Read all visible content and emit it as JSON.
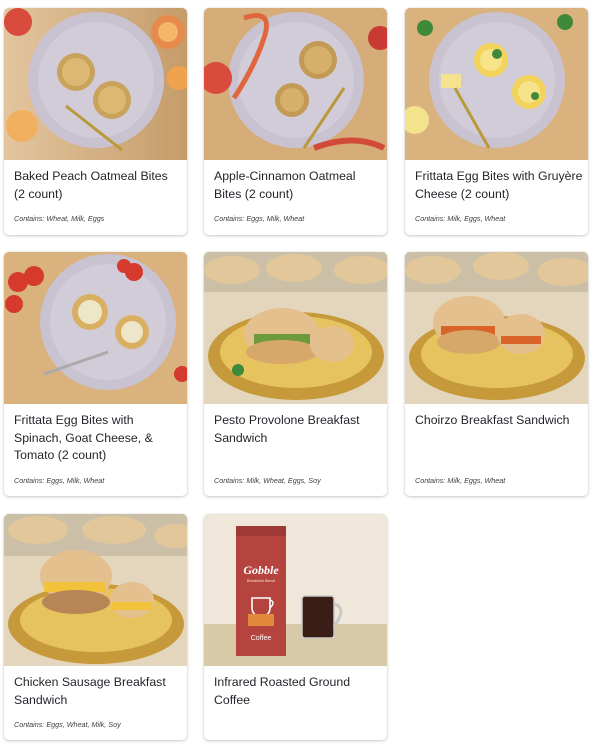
{
  "products": [
    {
      "name": "Baked Peach Oatmeal Bites (2 count)",
      "contains": "Contains: Wheat, Milk, Eggs",
      "image": "peach-oatmeal-bites-plate"
    },
    {
      "name": "Apple-Cinnamon Oatmeal Bites (2 count)",
      "contains": "Contains: Eggs, Milk, Wheat",
      "image": "apple-cinnamon-oatmeal-bites-plate"
    },
    {
      "name": "Frittata Egg Bites with Gruyère Cheese (2 count)",
      "contains": "Contains: Milk, Eggs, Wheat",
      "image": "gruyere-egg-bites-plate"
    },
    {
      "name": "Frittata Egg Bites with Spinach, Goat Cheese, & Tomato (2 count)",
      "contains": "Contains: Eggs, Milk, Wheat",
      "image": "spinach-egg-bites-plate"
    },
    {
      "name": "Pesto Provolone Breakfast Sandwich",
      "contains": "Contains: Milk, Wheat, Eggs, Soy",
      "image": "pesto-sandwich-plate"
    },
    {
      "name": "Choirzo Breakfast Sandwich",
      "contains": "Contains: Milk, Eggs, Wheat",
      "image": "chorizo-sandwich-plate"
    },
    {
      "name": "Chicken Sausage Breakfast Sandwich",
      "contains": "Contains: Eggs, Wheat, Milk, Soy",
      "image": "chicken-sausage-sandwich-plate"
    },
    {
      "name": "Infrared Roasted Ground Coffee",
      "contains": "",
      "image": "coffee-bag-and-mug"
    }
  ],
  "coffee_bag": {
    "brand": "Gobble",
    "tagline": "Breakfast Blend",
    "label": "Coffee"
  },
  "colors": {
    "wood": "#d9b27e",
    "plate_lavender": "#c9c2d0",
    "plate_yellow": "#e6c35e",
    "bag_red": "#b5443f"
  }
}
